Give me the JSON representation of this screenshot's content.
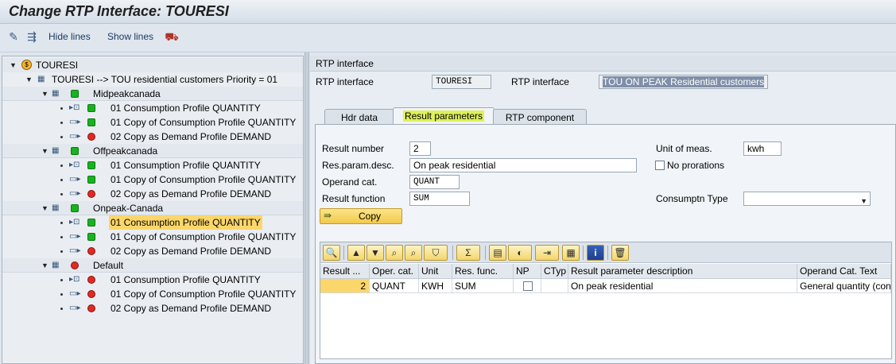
{
  "window": {
    "title": "Change RTP Interface: TOURESI"
  },
  "toolbar": {
    "hide_lines": "Hide lines",
    "show_lines": "Show lines"
  },
  "tree": {
    "root": "TOURESI",
    "profile": "TOURESI --> TOU residential customers Priority = 01",
    "groups": [
      {
        "name": "Midpeakcanada",
        "status": "green",
        "items": [
          "01 Consumption Profile QUANTITY",
          "01 Copy of Consumption Profile QUANTITY",
          "02 Copy as Demand Profile DEMAND"
        ]
      },
      {
        "name": "Offpeakcanada",
        "status": "green",
        "items": [
          "01 Consumption Profile QUANTITY",
          "01 Copy of Consumption Profile QUANTITY",
          "02 Copy as Demand Profile DEMAND"
        ]
      },
      {
        "name": "Onpeak-Canada",
        "status": "green",
        "items": [
          "01 Consumption Profile QUANTITY",
          "01 Copy of Consumption Profile QUANTITY",
          "02 Copy as Demand Profile DEMAND"
        ]
      },
      {
        "name": "Default",
        "status": "red",
        "items": [
          "01 Consumption Profile QUANTITY",
          "01 Copy of Consumption Profile QUANTITY",
          "02 Copy as Demand Profile DEMAND"
        ]
      }
    ]
  },
  "panel": {
    "title": "RTP interface",
    "rtp_label": "RTP interface",
    "rtp_value": "TOURESI",
    "rtp_desc_label": "RTP interface",
    "rtp_desc_value": "TOU ON PEAK Residential customers"
  },
  "tabs": [
    "Hdr data",
    "Result parameters",
    "RTP component"
  ],
  "form": {
    "result_number_label": "Result number",
    "result_number_value": "2",
    "res_param_desc_label": "Res.param.desc.",
    "res_param_desc_value": "On peak residential",
    "operand_cat_label": "Operand cat.",
    "operand_cat_value": "QUANT",
    "result_function_label": "Result function",
    "result_function_value": "SUM",
    "unit_label": "Unit of meas.",
    "unit_value": "kwh",
    "no_prorations_label": "No prorations",
    "consumptn_type_label": "Consumptn Type",
    "consumptn_type_value": "",
    "copy_button": "Copy"
  },
  "grid": {
    "headers": [
      "Result ...",
      "Oper. cat.",
      "Unit",
      "Res. func.",
      "NP",
      "CTyp",
      "Result parameter description",
      "Operand Cat. Text"
    ],
    "rows": [
      [
        "2",
        "QUANT",
        "KWH",
        "SUM",
        "",
        "",
        "On peak residential",
        "General quantity (con"
      ]
    ]
  },
  "colors": {
    "accent_yellow": "#fbd66a",
    "green_status": "#18b31f",
    "red_status": "#e02a22"
  }
}
